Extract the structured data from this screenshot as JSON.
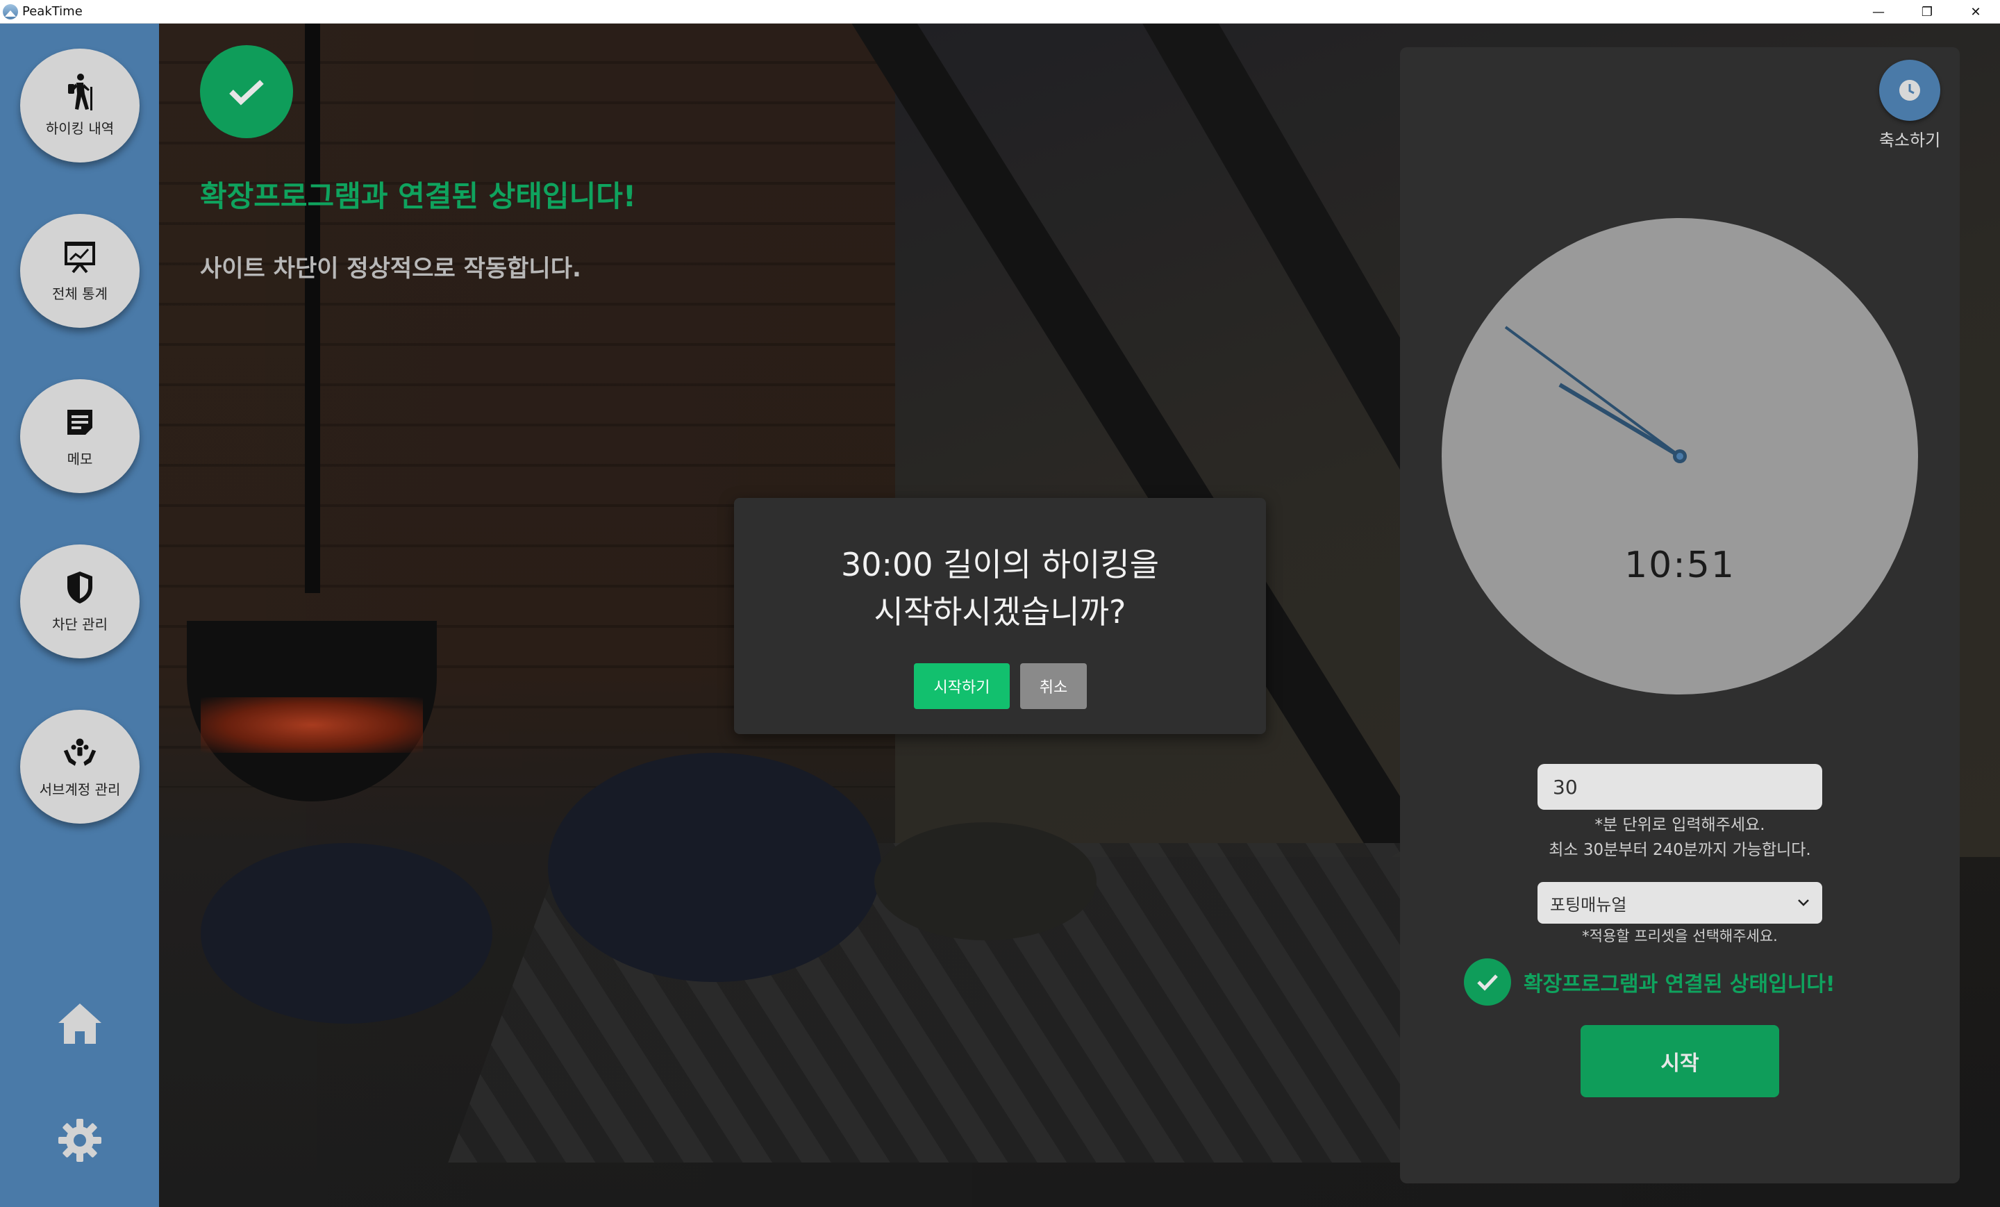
{
  "window": {
    "title": "PeakTime",
    "controls": [
      "—",
      "❐",
      "✕"
    ]
  },
  "sidebar": {
    "items": [
      {
        "label": "하이킹 내역",
        "icon": "hiker-icon"
      },
      {
        "label": "전체 통계",
        "icon": "chart-board-icon"
      },
      {
        "label": "메모",
        "icon": "memo-icon"
      },
      {
        "label": "차단 관리",
        "icon": "shield-icon"
      },
      {
        "label": "서브계정 관리",
        "icon": "hands-people-icon"
      }
    ],
    "home_icon": "home-icon",
    "settings_icon": "gear-icon"
  },
  "main": {
    "connection_title": "확장프로그램과 연결된 상태입니다!",
    "connection_subtitle": "사이트 차단이 정상적으로 작동합니다."
  },
  "panel": {
    "shrink_label": "축소하기",
    "clock_time": "10:51",
    "minutes_value": "30",
    "minutes_hint_1": "*분 단위로 입력해주세요.",
    "minutes_hint_2": "최소 30분부터 240분까지 가능합니다.",
    "preset_value": "포팅매뉴얼",
    "preset_hint": "*적용할 프리셋을 선택해주세요.",
    "status_text": "확장프로그램과 연결된 상태입니다!",
    "start_label": "시작"
  },
  "dialog": {
    "line1": "30:00 길이의 하이킹을",
    "line2": "시작하시겠습니까?",
    "confirm_label": "시작하기",
    "cancel_label": "취소"
  },
  "colors": {
    "sidebar": "#4a7aa8",
    "accent_green": "#0f9d5a",
    "confirm_green": "#12c06e",
    "panel_bg": "#2f2f2f"
  }
}
